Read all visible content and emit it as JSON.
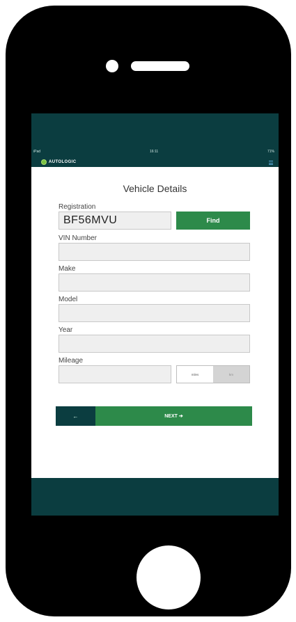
{
  "status": {
    "device": "iPad",
    "time": "16:11",
    "battery": "71%"
  },
  "app": {
    "brand": "AUTOLOGIC"
  },
  "page": {
    "title": "Vehicle Details"
  },
  "form": {
    "registration": {
      "label": "Registration",
      "value": "BF56MVU"
    },
    "find_label": "Find",
    "vin": {
      "label": "VIN Number",
      "value": ""
    },
    "make": {
      "label": "Make",
      "value": ""
    },
    "model": {
      "label": "Model",
      "value": ""
    },
    "year": {
      "label": "Year",
      "value": ""
    },
    "mileage": {
      "label": "Mileage",
      "value": ""
    },
    "units": {
      "miles": "miles",
      "km": "km",
      "selected": "miles"
    }
  },
  "nav": {
    "back_icon": "left-arrow-icon",
    "back_glyph": "←",
    "next_label": "NEXT",
    "next_icon": "arrow-right-icon",
    "next_glyph": "➔"
  },
  "colors": {
    "brand_dark": "#0b3d40",
    "accent_green": "#2d8a4a"
  }
}
